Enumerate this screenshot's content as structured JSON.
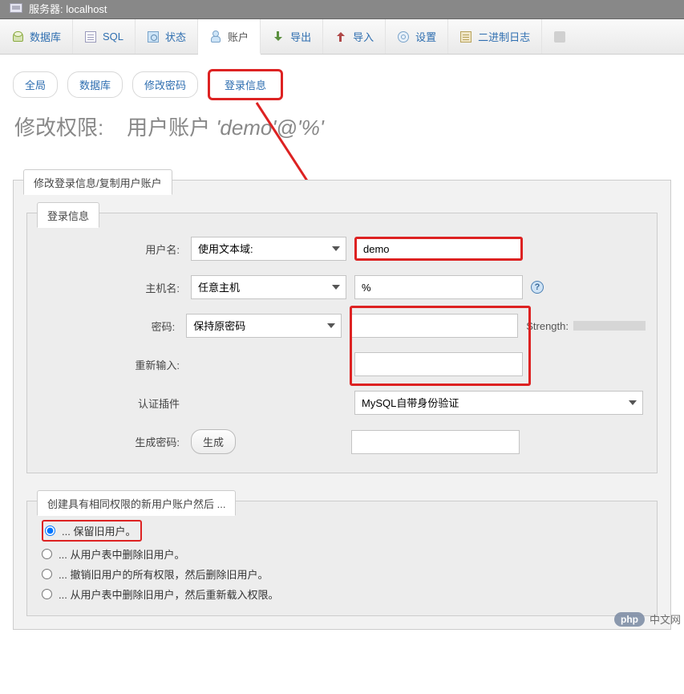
{
  "titlebar": {
    "label": "服务器: localhost"
  },
  "toptabs": [
    {
      "id": "database",
      "label": "数据库",
      "icon": "database-icon"
    },
    {
      "id": "sql",
      "label": "SQL",
      "icon": "sql-icon"
    },
    {
      "id": "status",
      "label": "状态",
      "icon": "status-icon"
    },
    {
      "id": "account",
      "label": "账户",
      "icon": "user-icon",
      "active": true
    },
    {
      "id": "export",
      "label": "导出",
      "icon": "export-icon"
    },
    {
      "id": "import",
      "label": "导入",
      "icon": "import-icon"
    },
    {
      "id": "settings",
      "label": "设置",
      "icon": "settings-icon"
    },
    {
      "id": "binlog",
      "label": "二进制日志",
      "icon": "binlog-icon"
    }
  ],
  "subnav": {
    "global": "全局",
    "database": "数据库",
    "chpass": "修改密码",
    "login": "登录信息"
  },
  "heading": {
    "prefix": "修改权限:",
    "middle": "用户账户",
    "account": "'demo'@'%'"
  },
  "panel1": {
    "legend": "修改登录信息/复制用户账户"
  },
  "panel_login": {
    "legend": "登录信息"
  },
  "form": {
    "username": {
      "label": "用户名:",
      "mode": "使用文本域:",
      "value": "demo"
    },
    "host": {
      "label": "主机名:",
      "mode": "任意主机",
      "value": "%"
    },
    "password": {
      "label": "密码:",
      "mode": "保持原密码",
      "value": "",
      "strength_label": "Strength:"
    },
    "retype": {
      "label": "重新输入:",
      "value": ""
    },
    "authplugin": {
      "label": "认证插件",
      "value": "MySQL自带身份验证"
    },
    "genpass": {
      "label": "生成密码:",
      "button": "生成",
      "value": ""
    }
  },
  "panel_copy": {
    "legend": "创建具有相同权限的新用户账户然后 ...",
    "options": [
      "... 保留旧用户。",
      "... 从用户表中删除旧用户。",
      "... 撤销旧用户的所有权限，然后删除旧用户。",
      "... 从用户表中删除旧用户，然后重新载入权限。"
    ],
    "selected_index": 0
  },
  "watermark": {
    "logo": "php",
    "text": "中文网"
  },
  "colors": {
    "link": "#2e6eb0",
    "highlight": "#d22222",
    "panel_bg": "#f2f2f2"
  }
}
